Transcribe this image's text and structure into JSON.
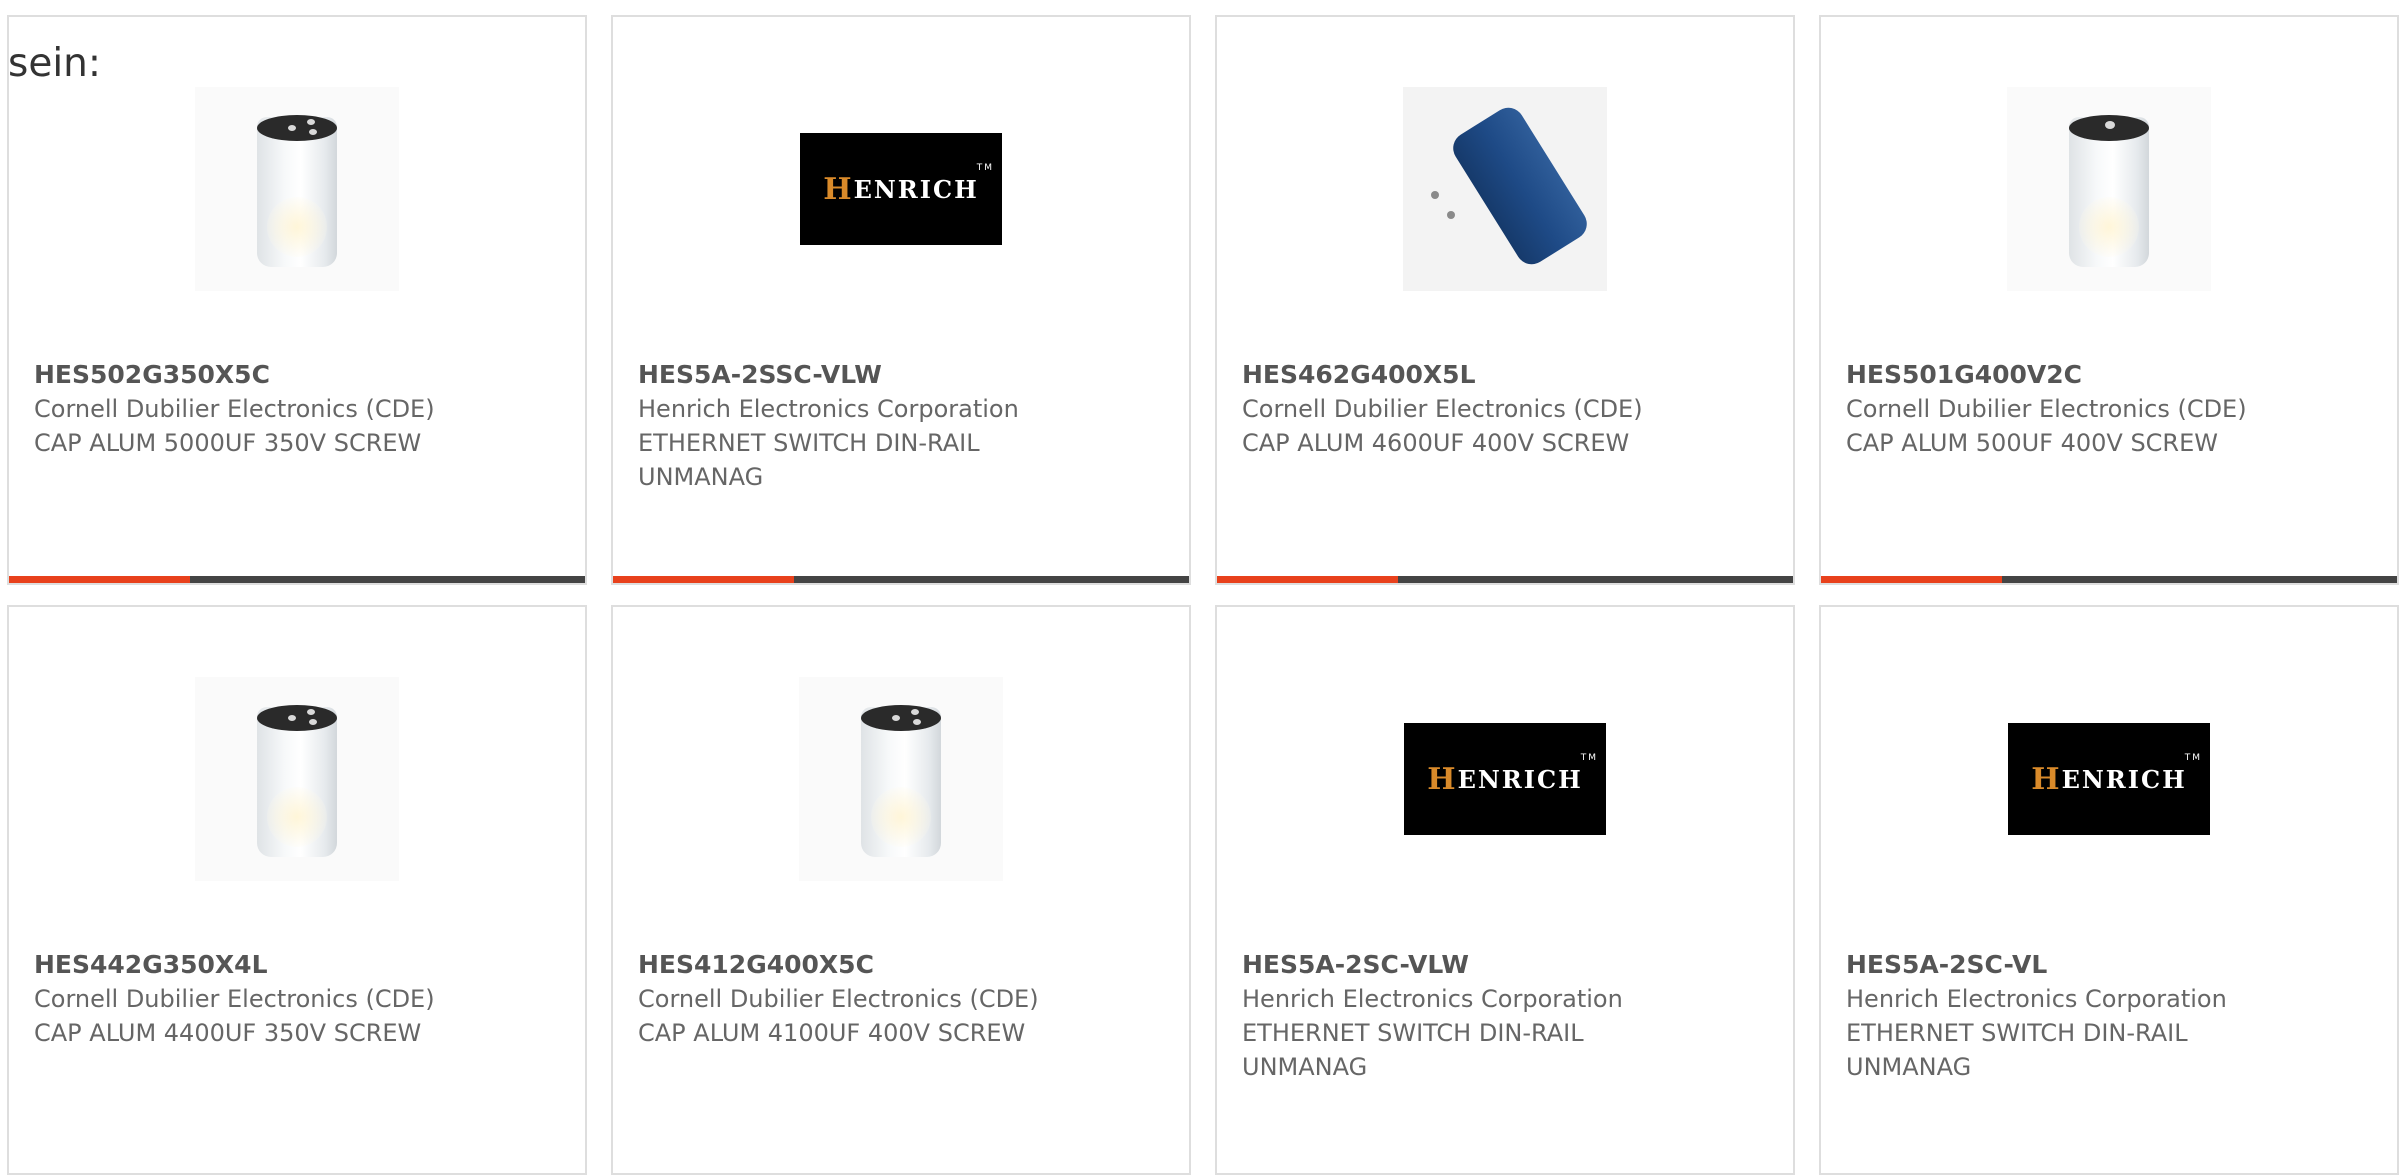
{
  "intro_text": "sein:",
  "accent_color": "#e8411c",
  "bar_color": "#444444",
  "products": [
    {
      "part_number": "HES502G350X5C",
      "manufacturer": "Cornell Dubilier Electronics (CDE)",
      "description": "CAP ALUM 5000UF 350V SCREW",
      "image": "capacitor-white-icon"
    },
    {
      "part_number": "HES5A-2SSC-VLW",
      "manufacturer": "Henrich Electronics Corporation",
      "description": "ETHERNET SWITCH DIN-RAIL UNMANAG",
      "image": "henrich-logo",
      "logo_text": "ENRICH",
      "logo_initial": "H",
      "logo_tm": "TM"
    },
    {
      "part_number": "HES462G400X5L",
      "manufacturer": "Cornell Dubilier Electronics (CDE)",
      "description": "CAP ALUM 4600UF 400V SCREW",
      "image": "capacitor-blue-icon"
    },
    {
      "part_number": "HES501G400V2C",
      "manufacturer": "Cornell Dubilier Electronics (CDE)",
      "description": "CAP ALUM 500UF 400V SCREW",
      "image": "capacitor-white-single-terminal-icon"
    },
    {
      "part_number": "HES442G350X4L",
      "manufacturer": "Cornell Dubilier Electronics (CDE)",
      "description": "CAP ALUM 4400UF 350V SCREW",
      "image": "capacitor-white-icon"
    },
    {
      "part_number": "HES412G400X5C",
      "manufacturer": "Cornell Dubilier Electronics (CDE)",
      "description": "CAP ALUM 4100UF 400V SCREW",
      "image": "capacitor-white-icon"
    },
    {
      "part_number": "HES5A-2SC-VLW",
      "manufacturer": "Henrich Electronics Corporation",
      "description": "ETHERNET SWITCH DIN-RAIL UNMANAG",
      "image": "henrich-logo",
      "logo_text": "ENRICH",
      "logo_initial": "H",
      "logo_tm": "TM"
    },
    {
      "part_number": "HES5A-2SC-VL",
      "manufacturer": "Henrich Electronics Corporation",
      "description": "ETHERNET SWITCH DIN-RAIL UNMANAG",
      "image": "henrich-logo",
      "logo_text": "ENRICH",
      "logo_initial": "H",
      "logo_tm": "TM"
    }
  ]
}
